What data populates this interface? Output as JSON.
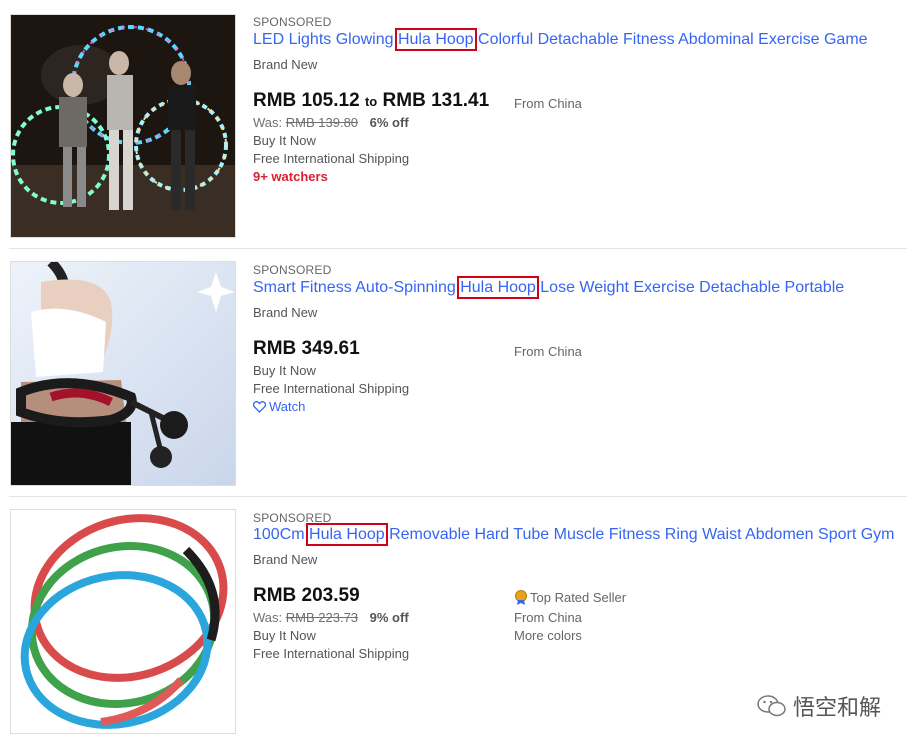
{
  "listings": [
    {
      "sponsored": "SPONSORED",
      "title_pre": "LED Lights Glowing ",
      "title_hl": "Hula Hoop",
      "title_post": " Colorful Detachable Fitness Abdominal Exercise Game",
      "condition": "Brand New",
      "price_low": "RMB 105.12",
      "price_to": "to",
      "price_high": "RMB 131.41",
      "from": "From China",
      "was_label": "Was:",
      "was_price": "RMB 139.80",
      "discount": "6% off",
      "buy": "Buy It Now",
      "shipping": "Free International Shipping",
      "watchers": "9+ watchers"
    },
    {
      "sponsored": "SPONSORED",
      "title_pre": "Smart Fitness Auto-Spinning ",
      "title_hl": "Hula Hoop",
      "title_post": " Lose Weight Exercise Detachable Portable",
      "condition": "Brand New",
      "price": "RMB 349.61",
      "from": "From China",
      "buy": "Buy It Now",
      "shipping": "Free International Shipping",
      "watch": "Watch"
    },
    {
      "sponsored": "SPONSORED",
      "title_pre": "100Cm ",
      "title_hl": "Hula Hoop",
      "title_post": " Removable Hard Tube Muscle Fitness Ring Waist Abdomen Sport Gym",
      "condition": "Brand New",
      "price": "RMB 203.59",
      "was_label": "Was:",
      "was_price": "RMB 223.73",
      "discount": "9% off",
      "buy": "Buy It Now",
      "shipping": "Free International Shipping",
      "top_rated": "Top Rated Seller",
      "from": "From China",
      "more_colors": "More colors"
    }
  ],
  "watermark": "悟空和解",
  "colors": {
    "link": "#3665f3",
    "highlight_box": "#d0021b",
    "watchers": "#dd1e31"
  }
}
